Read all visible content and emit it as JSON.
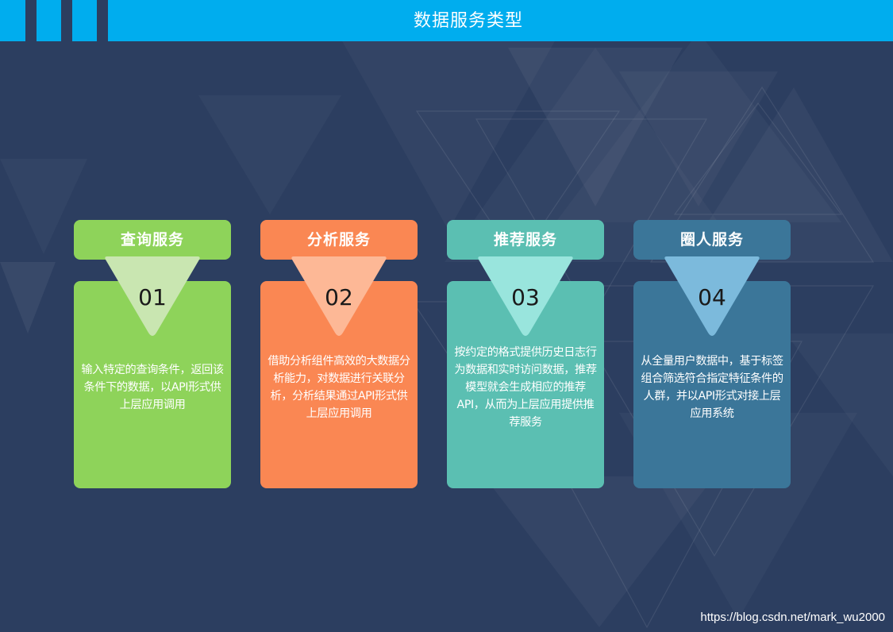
{
  "header": {
    "title": "数据服务类型"
  },
  "cards": [
    {
      "title": "查询服务",
      "number": "01",
      "description": "输入特定的查询条件，返回该条件下的数据，以API形式供上层应用调用",
      "colors": {
        "head": "#8ed35a",
        "body": "#8ed35a",
        "triangle": "#c9e6b1"
      }
    },
    {
      "title": "分析服务",
      "number": "02",
      "description": "借助分析组件高效的大数据分析能力，对数据进行关联分析，分析结果通过API形式供上层应用调用",
      "colors": {
        "head": "#fa8753",
        "body": "#fa8753",
        "triangle": "#fdb896"
      }
    },
    {
      "title": "推荐服务",
      "number": "03",
      "description": "按约定的格式提供历史日志行为数据和实时访问数据，推荐模型就会生成相应的推荐API，从而为上层应用提供推荐服务",
      "colors": {
        "head": "#5bbfb2",
        "body": "#5bbfb2",
        "triangle": "#99e5dd"
      }
    },
    {
      "title": "圈人服务",
      "number": "04",
      "description": "从全量用户数据中，基于标签组合筛选符合指定特征条件的人群，并以API形式对接上层应用系统",
      "colors": {
        "head": "#3b7699",
        "body": "#3b7699",
        "triangle": "#7cbadc"
      }
    }
  ],
  "watermark": "https://blog.csdn.net/mark_wu2000",
  "theme": {
    "topbar": "#00adee",
    "background": "#2c3e60"
  }
}
